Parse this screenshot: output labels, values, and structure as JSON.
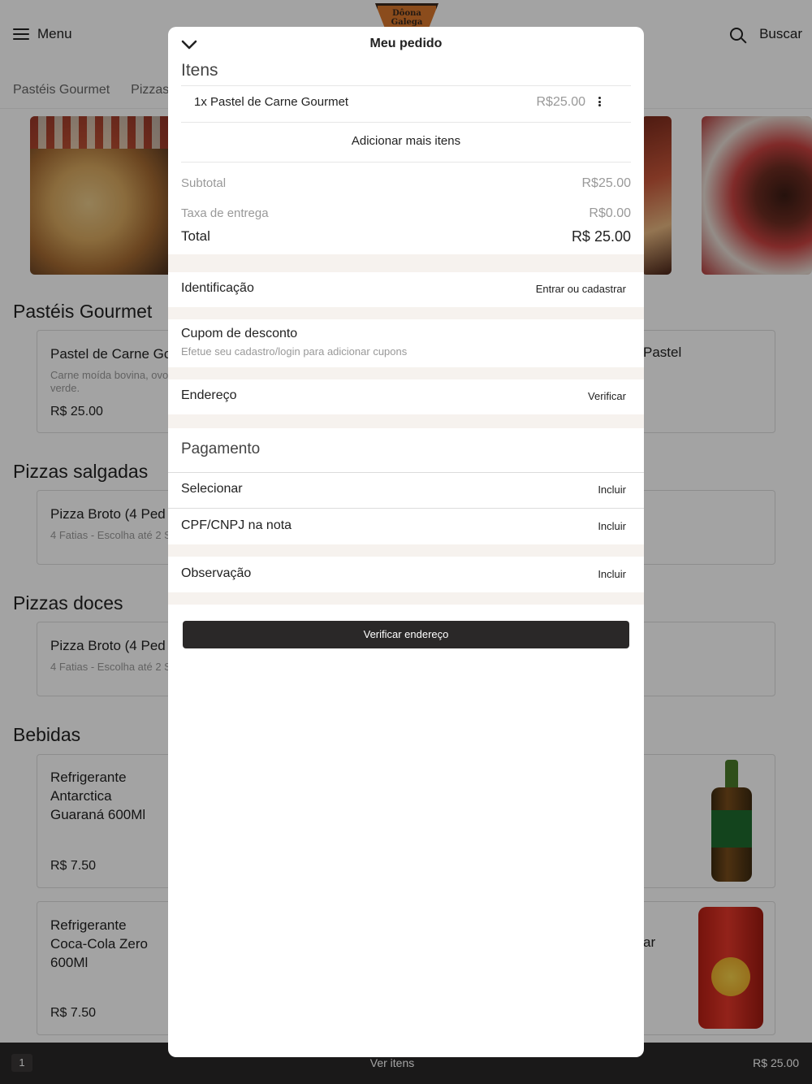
{
  "header": {
    "menu_label": "Menu",
    "search_label": "Buscar",
    "logo_text_1": "Dôona",
    "logo_text_2": "Galega"
  },
  "categories": [
    "Pastéis Gourmet",
    "Pizzas"
  ],
  "sections": {
    "pasteis": "Pastéis Gourmet",
    "pizzas_salgadas": "Pizzas salgadas",
    "pizzas_doces": "Pizzas doces",
    "bebidas": "Bebidas"
  },
  "products": {
    "pastel_carne": {
      "name": "Pastel de Carne Go",
      "desc": "Carne moída bovina, ovo",
      "desc2": "verde.",
      "price": "R$ 25.00"
    },
    "pastel_right": "Pastel",
    "pizza_broto_salgada": {
      "name": "Pizza Broto (4 Ped",
      "desc": "4 Fatias - Escolha até 2 S"
    },
    "pizza_broto_doce": {
      "name": "Pizza Broto (4 Ped",
      "desc": "4 Fatias - Escolha até 2 S"
    },
    "guarana": {
      "name1": "Refrigerante",
      "name2": "Antarctica",
      "name3": "Guaraná 600Ml",
      "price": "R$ 7.50"
    },
    "coca": {
      "name1": "Refrigerante",
      "name2": "Coca-Cola Zero",
      "name3": "600Ml",
      "price": "R$ 7.50"
    },
    "coca_right": "ar"
  },
  "bottom_bar": {
    "count": "1",
    "label": "Ver itens",
    "total": "R$ 25.00"
  },
  "modal": {
    "title": "Meu pedido",
    "items_heading": "Itens",
    "item": {
      "name": "1x Pastel de Carne Gourmet",
      "price": "R$25.00"
    },
    "add_more": "Adicionar mais itens",
    "subtotal_label": "Subtotal",
    "subtotal_value": "R$25.00",
    "delivery_label": "Taxa de entrega",
    "delivery_value": "R$0.00",
    "total_label": "Total",
    "total_value": "R$ 25.00",
    "identification_label": "Identificação",
    "identification_action": "Entrar ou cadastrar",
    "coupon_label": "Cupom de desconto",
    "coupon_sub": "Efetue seu cadastro/login para adicionar cupons",
    "address_label": "Endereço",
    "address_action": "Verificar",
    "payment_heading": "Pagamento",
    "select_label": "Selecionar",
    "select_action": "Incluir",
    "cpf_label": "CPF/CNPJ na nota",
    "cpf_action": "Incluir",
    "obs_label": "Observação",
    "obs_action": "Incluir",
    "cta_label": "Verificar endereço"
  },
  "colors": {
    "dark": "#2a2828",
    "separator": "#f6f2ee",
    "muted_text": "#999999"
  }
}
